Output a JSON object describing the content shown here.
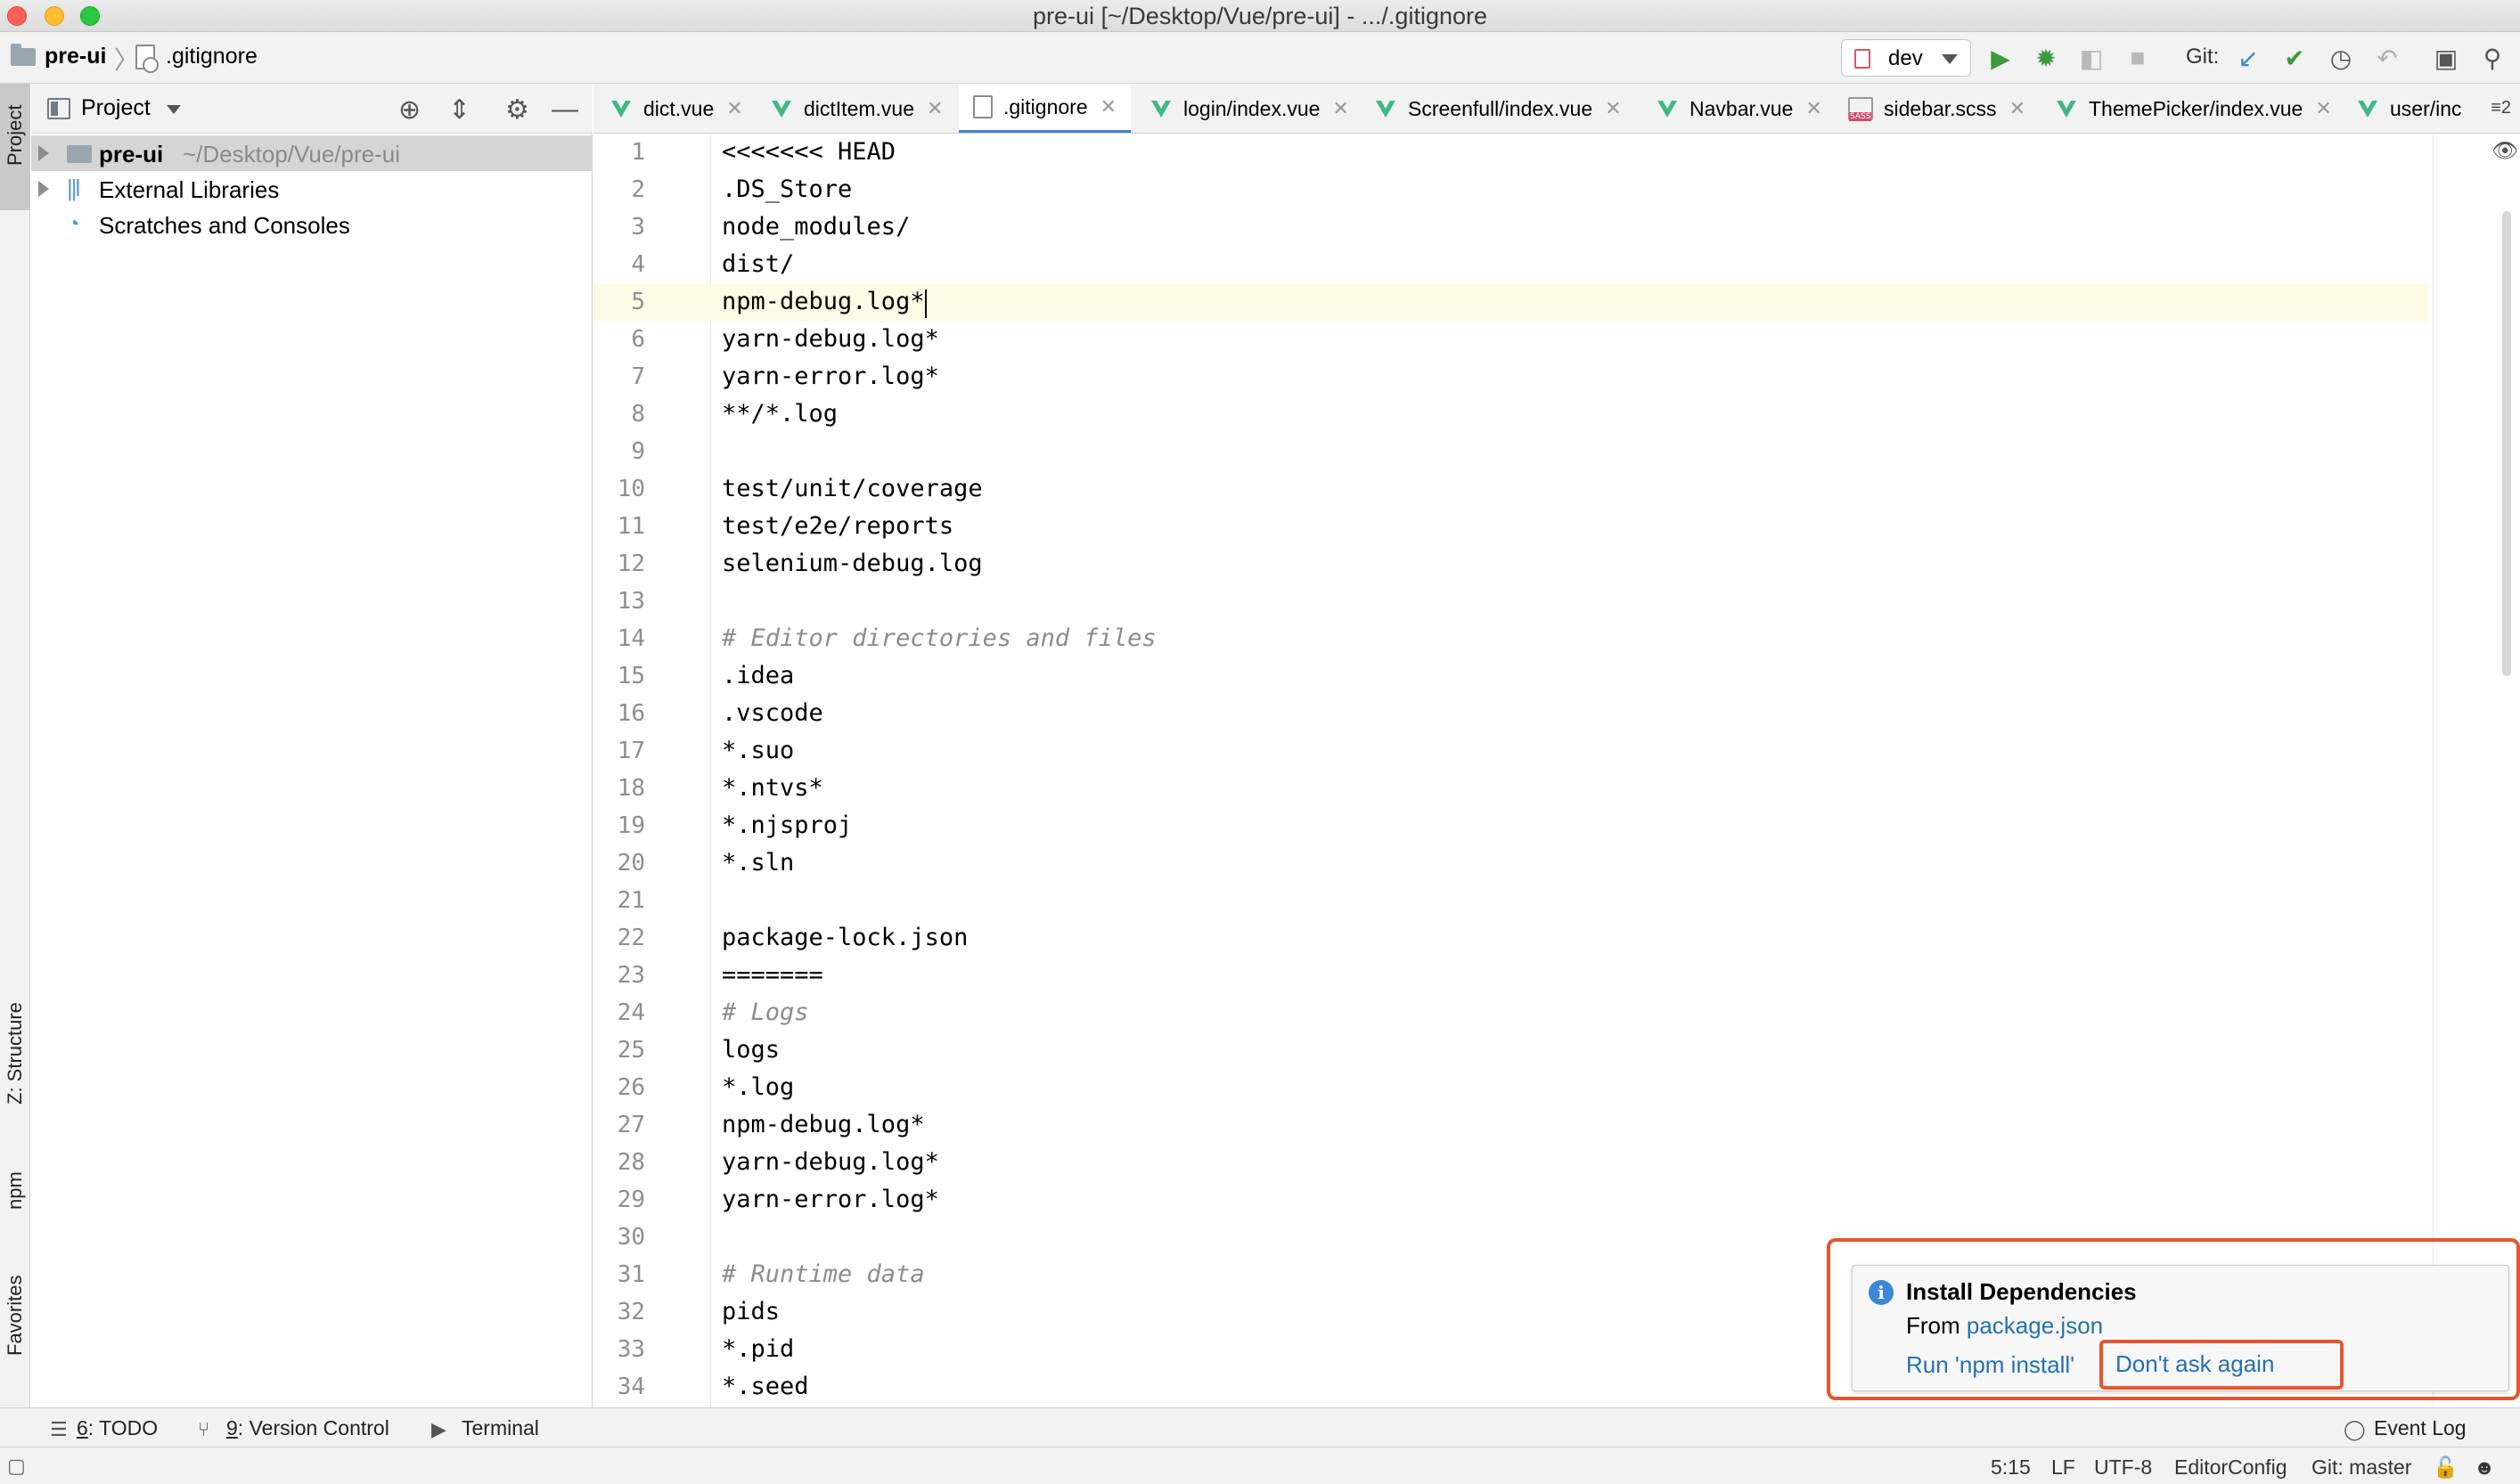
{
  "window": {
    "title": "pre-ui [~/Desktop/Vue/pre-ui] - .../.gitignore"
  },
  "navbar": {
    "project": "pre-ui",
    "file": ".gitignore",
    "branch": "dev",
    "git_label": "Git:"
  },
  "left_strip": {
    "project": "Project",
    "structure": "Z: Structure",
    "npm": "npm",
    "favorites": "Favorites"
  },
  "project_panel": {
    "title": "Project",
    "tree": [
      {
        "label": "pre-ui",
        "detail": "~/Desktop/Vue/pre-ui"
      },
      {
        "label": "External Libraries"
      },
      {
        "label": "Scratches and Consoles"
      }
    ]
  },
  "tabs": [
    {
      "label": "dict.vue",
      "icon": "vue-icon"
    },
    {
      "label": "dictItem.vue",
      "icon": "vue-icon"
    },
    {
      "label": ".gitignore",
      "icon": "gitignore-file-icon",
      "active": true
    },
    {
      "label": "login/index.vue",
      "icon": "vue-icon"
    },
    {
      "label": "Screenfull/index.vue",
      "icon": "vue-icon"
    },
    {
      "label": "Navbar.vue",
      "icon": "vue-icon"
    },
    {
      "label": "sidebar.scss",
      "icon": "sass-icon"
    },
    {
      "label": "ThemePicker/index.vue",
      "icon": "vue-icon"
    },
    {
      "label": "user/inc",
      "icon": "vue-icon"
    }
  ],
  "tabs_more": "≡2",
  "editor": {
    "current_line": 5,
    "lines": [
      "<<<<<<< HEAD",
      ".DS_Store",
      "node_modules/",
      "dist/",
      "npm-debug.log*",
      "yarn-debug.log*",
      "yarn-error.log*",
      "**/*.log",
      "",
      "test/unit/coverage",
      "test/e2e/reports",
      "selenium-debug.log",
      "",
      "# Editor directories and files",
      ".idea",
      ".vscode",
      "*.suo",
      "*.ntvs*",
      "*.njsproj",
      "*.sln",
      "",
      "package-lock.json",
      "=======",
      "# Logs",
      "logs",
      "*.log",
      "npm-debug.log*",
      "yarn-debug.log*",
      "yarn-error.log*",
      "",
      "# Runtime data",
      "pids",
      "*.pid",
      "*.seed"
    ]
  },
  "notification": {
    "title": "Install Dependencies",
    "from_prefix": "From ",
    "from_link": "package.json",
    "action_run": "Run 'npm install'",
    "action_dismiss": "Don't ask again"
  },
  "bottom_tools": {
    "todo_num": "6",
    "todo": ": TODO",
    "vcs_num": "9",
    "vcs": ": Version Control",
    "terminal": "Terminal",
    "event_log": "Event Log"
  },
  "status": {
    "position": "5:15",
    "line_sep": "LF",
    "encoding": "UTF-8",
    "editorconfig": "EditorConfig",
    "git": "Git: master"
  },
  "colors": {
    "accent": "#4083c9",
    "highlight": "#e5552f",
    "link": "#2470b3",
    "vue": "#41b883"
  }
}
